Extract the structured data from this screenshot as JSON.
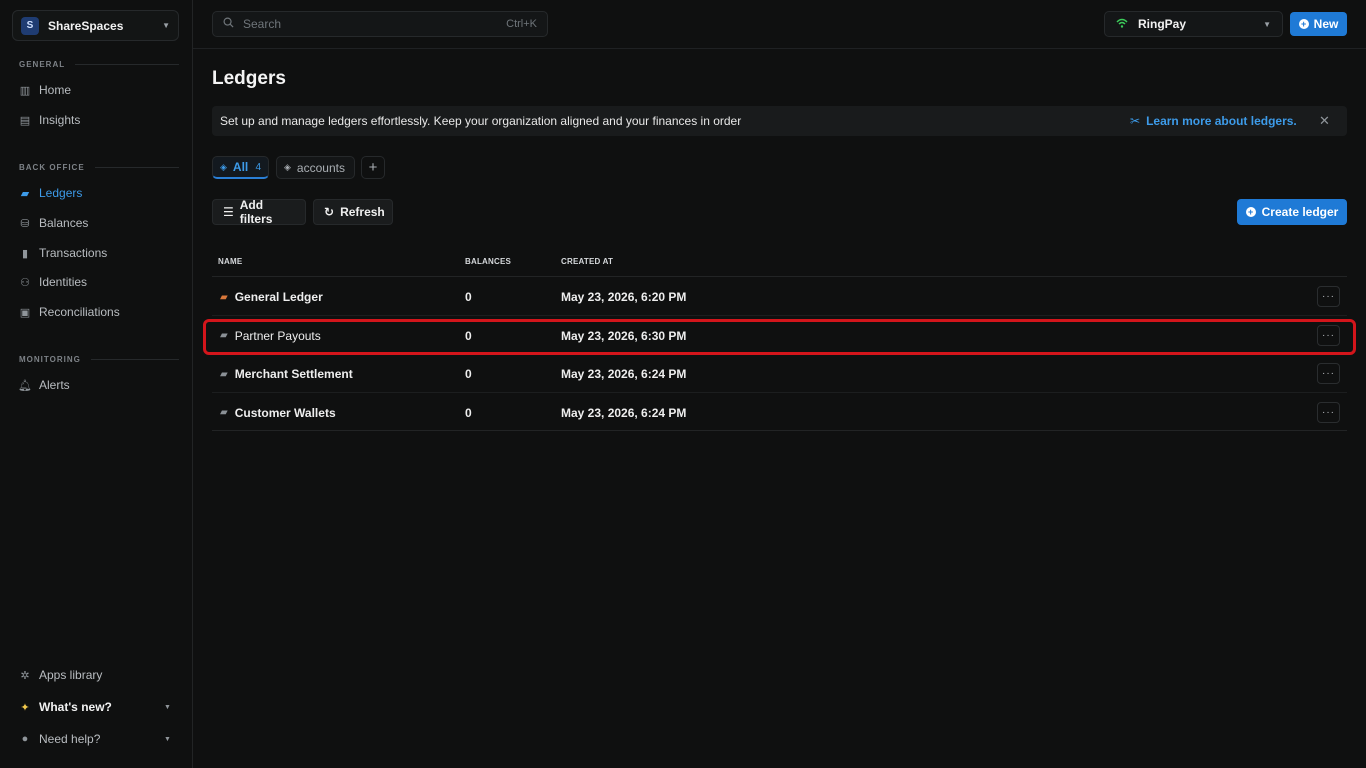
{
  "workspace": {
    "badge": "S",
    "name": "ShareSpaces"
  },
  "sidebar": {
    "general_label": "GENERAL",
    "general": [
      {
        "label": "Home",
        "icon": "building-icon"
      },
      {
        "label": "Insights",
        "icon": "chart-icon"
      }
    ],
    "backoffice_label": "BACK OFFICE",
    "backoffice": [
      {
        "label": "Ledgers",
        "icon": "folder-icon",
        "active": true
      },
      {
        "label": "Balances",
        "icon": "coins-icon"
      },
      {
        "label": "Transactions",
        "icon": "transactions-icon"
      },
      {
        "label": "Identities",
        "icon": "users-icon"
      },
      {
        "label": "Reconciliations",
        "icon": "reconcile-icon"
      }
    ],
    "monitoring_label": "MONITORING",
    "monitoring": [
      {
        "label": "Alerts",
        "icon": "bell-icon"
      }
    ],
    "footer": [
      {
        "label": "Apps library",
        "icon": "puzzle-icon"
      },
      {
        "label": "What's new?",
        "icon": "sparkle-icon"
      },
      {
        "label": "Need help?",
        "icon": "help-icon"
      }
    ]
  },
  "topbar": {
    "search_placeholder": "Search",
    "search_shortcut": "Ctrl+K",
    "org_name": "RingPay",
    "new_label": "New"
  },
  "page": {
    "title": "Ledgers",
    "banner_text": "Set up and manage ledgers effortlessly. Keep your organization aligned and your finances in order",
    "learn_more": "Learn more about ledgers.",
    "close": "✕"
  },
  "tabs": {
    "all_label": "All",
    "all_count": "4",
    "accounts_label": "accounts",
    "add": "+"
  },
  "toolbar": {
    "filters_label": "Add filters",
    "refresh_label": "Refresh",
    "create_label": "Create ledger"
  },
  "table": {
    "headers": {
      "name": "NAME",
      "balances": "BALANCES",
      "created": "CREATED AT"
    },
    "rows": [
      {
        "name": "General Ledger",
        "balances": "0",
        "created": "May 23, 2026, 6:20 PM"
      },
      {
        "name": "Partner Payouts",
        "balances": "0",
        "created": "May 23, 2026, 6:30 PM"
      },
      {
        "name": "Merchant Settlement",
        "balances": "0",
        "created": "May 23, 2026, 6:24 PM"
      },
      {
        "name": "Customer Wallets",
        "balances": "0",
        "created": "May 23, 2026, 6:24 PM"
      }
    ],
    "more_label": "···"
  },
  "colors": {
    "accent": "#1f7ad6",
    "active_link": "#3d9be9",
    "highlight": "#d3151b",
    "folder_orange": "#d9773a"
  }
}
